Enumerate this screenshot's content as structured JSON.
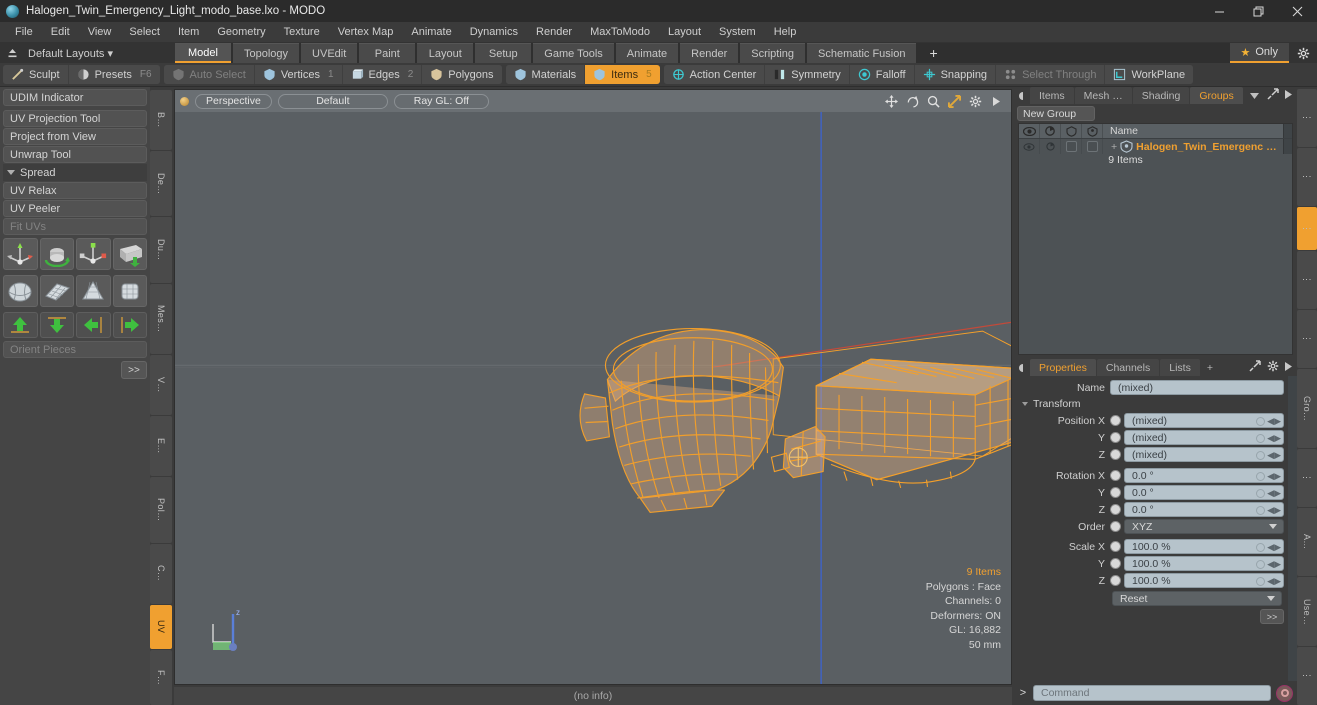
{
  "window": {
    "title": "Halogen_Twin_Emergency_Light_modo_base.lxo - MODO",
    "logo_icon": "modo-logo-icon",
    "minimize_icon": "minimize-icon",
    "maximize_icon": "maximize-icon",
    "close_icon": "close-icon"
  },
  "menubar": {
    "items": [
      "File",
      "Edit",
      "View",
      "Select",
      "Item",
      "Geometry",
      "Texture",
      "Vertex Map",
      "Animate",
      "Dynamics",
      "Render",
      "MaxToModo",
      "Layout",
      "System",
      "Help"
    ]
  },
  "layoutbar": {
    "upload_icon": "upload-icon",
    "default_layouts": "Default Layouts",
    "tabs": [
      {
        "label": "Model",
        "active": true
      },
      {
        "label": "Topology",
        "active": false
      },
      {
        "label": "UVEdit",
        "active": false
      },
      {
        "label": "Paint",
        "active": false
      },
      {
        "label": "Layout",
        "active": false
      },
      {
        "label": "Setup",
        "active": false
      },
      {
        "label": "Game Tools",
        "active": false
      },
      {
        "label": "Animate",
        "active": false
      },
      {
        "label": "Render",
        "active": false
      },
      {
        "label": "Scripting",
        "active": false
      },
      {
        "label": "Schematic Fusion",
        "active": false
      }
    ],
    "add_tab": "+",
    "only_label": "Only",
    "star_icon": "star-icon",
    "gear_icon": "gear-icon"
  },
  "modebar": {
    "group1": [
      {
        "label": "Sculpt",
        "icon": "brush-icon",
        "state": "normal",
        "num": ""
      },
      {
        "label": "Presets",
        "icon": "sphere-icon",
        "state": "normal",
        "num": "F6"
      }
    ],
    "group2": [
      {
        "label": "Auto Select",
        "icon": "shield-icon",
        "state": "disabled",
        "num": ""
      },
      {
        "label": "Vertices",
        "icon": "shield-icon",
        "state": "normal",
        "num": "1"
      },
      {
        "label": "Edges",
        "icon": "cube-icon",
        "state": "normal",
        "num": "2"
      },
      {
        "label": "Polygons",
        "icon": "shield-icon",
        "state": "normal",
        "num": ""
      }
    ],
    "group3": [
      {
        "label": "Materials",
        "icon": "shield-icon",
        "state": "normal",
        "num": ""
      },
      {
        "label": "Items",
        "icon": "shield-icon",
        "state": "active",
        "num": "5"
      }
    ],
    "group4": [
      {
        "label": "Action Center",
        "icon": "crosshair-icon",
        "state": "normal",
        "num": ""
      },
      {
        "label": "Symmetry",
        "icon": "symmetry-icon",
        "state": "normal",
        "num": ""
      },
      {
        "label": "Falloff",
        "icon": "falloff-icon",
        "state": "normal",
        "num": ""
      },
      {
        "label": "Snapping",
        "icon": "snap-icon",
        "state": "normal",
        "num": ""
      },
      {
        "label": "Select Through",
        "icon": "select-through-icon",
        "state": "disabled",
        "num": ""
      },
      {
        "label": "WorkPlane",
        "icon": "workplane-icon",
        "state": "normal",
        "num": ""
      }
    ]
  },
  "leftpanel": {
    "buttons": [
      {
        "label": "UDIM Indicator",
        "dim": false
      },
      {
        "label": "UV Projection Tool",
        "dim": false
      },
      {
        "label": "Project from View",
        "dim": false
      },
      {
        "label": "Unwrap Tool",
        "dim": false
      }
    ],
    "section": "Spread",
    "buttons2": [
      {
        "label": "UV Relax",
        "dim": false
      },
      {
        "label": "UV Peeler",
        "dim": false
      },
      {
        "label": "Fit UVs",
        "dim": true
      }
    ],
    "icon_row1": [
      "uv-move-icon",
      "uv-rotate-icon",
      "uv-scale-icon",
      "uv-fit-icon"
    ],
    "icon_row2": [
      "uv-sphere-icon",
      "uv-plane-icon",
      "uv-cone-icon",
      "uv-cube-icon"
    ],
    "arrow_row": [
      "arrow-up-icon",
      "arrow-down-icon",
      "arrow-left-icon",
      "arrow-right-icon"
    ],
    "orient_pieces": "Orient Pieces",
    "fastforward": ">>",
    "vtabs": [
      {
        "label": "B…",
        "active": false
      },
      {
        "label": "De…",
        "active": false
      },
      {
        "label": "Du…",
        "active": false
      },
      {
        "label": "Mes…",
        "active": false
      },
      {
        "label": "V…",
        "active": false
      },
      {
        "label": "E…",
        "active": false
      },
      {
        "label": "Pol…",
        "active": false
      },
      {
        "label": "C…",
        "active": false
      },
      {
        "label": "UV",
        "active": true
      },
      {
        "label": "F…",
        "active": false
      }
    ]
  },
  "viewport": {
    "dot_icon": "viewport-dot-icon",
    "view_mode": "Perspective",
    "shading": "Default",
    "raygl": "Ray GL: Off",
    "tool_icons": [
      "move-icon",
      "rotate-icon",
      "zoom-icon",
      "fit-icon",
      "gear-icon",
      "play-icon"
    ],
    "info": {
      "items": "9 Items",
      "polygons": "Polygons : Face",
      "channels": "Channels: 0",
      "deformers": "Deformers: ON",
      "gl": "GL: 16,882",
      "scale": "50 mm"
    },
    "axis_gizmo_icon": "axis-gizmo-icon",
    "model_color": "#f5a02a",
    "bg_color": "#5a5f63"
  },
  "statusbar": {
    "text": "(no info)"
  },
  "rightpanel": {
    "top_tabs": [
      {
        "label": "Items",
        "active": false
      },
      {
        "label": "Mesh …",
        "active": false
      },
      {
        "label": "Shading",
        "active": false
      },
      {
        "label": "Groups",
        "active": true
      }
    ],
    "top_tab_icons": [
      "chevron-down-icon",
      "expand-icon",
      "play-icon"
    ],
    "new_group_btn": "New Group",
    "group_columns": [
      "eye-icon",
      "render-icon",
      "lock-icon",
      "wire-icon"
    ],
    "name_header": "Name",
    "group_item": {
      "icon": "group-item-icon",
      "name": "Halogen_Twin_Emergenc …",
      "subtitle": "9 Items"
    },
    "prop_tabs": [
      {
        "label": "Properties",
        "active": true
      },
      {
        "label": "Channels",
        "active": false
      },
      {
        "label": "Lists",
        "active": false
      },
      {
        "label": "+",
        "active": false
      }
    ],
    "prop_tab_icons": [
      "expand-icon",
      "gear-icon",
      "play-icon"
    ],
    "properties": {
      "name_label": "Name",
      "name_value": "(mixed)",
      "transform_section": "Transform",
      "rows": [
        {
          "label": "Position X",
          "value": "(mixed)"
        },
        {
          "label": "Y",
          "value": "(mixed)"
        },
        {
          "label": "Z",
          "value": "(mixed)"
        },
        {
          "label": "Rotation X",
          "value": "0.0 °"
        },
        {
          "label": "Y",
          "value": "0.0 °"
        },
        {
          "label": "Z",
          "value": "0.0 °"
        }
      ],
      "order_label": "Order",
      "order_value": "XYZ",
      "scale_rows": [
        {
          "label": "Scale X",
          "value": "100.0 %"
        },
        {
          "label": "Y",
          "value": "100.0 %"
        },
        {
          "label": "Z",
          "value": "100.0 %"
        }
      ],
      "reset_value": "Reset",
      "fastforward": ">>"
    },
    "vtabs": [
      {
        "label": "⋮",
        "active": false
      },
      {
        "label": "⋮",
        "active": false
      },
      {
        "label": "⋮",
        "active": true
      },
      {
        "label": "⋮",
        "active": false
      },
      {
        "label": "⋮",
        "active": false
      },
      {
        "label": "Gro…",
        "active": false
      },
      {
        "label": "⋮",
        "active": false
      },
      {
        "label": "A…",
        "active": false
      },
      {
        "label": "Use…",
        "active": false
      },
      {
        "label": "⋮",
        "active": false
      }
    ]
  },
  "command": {
    "prompt": ">",
    "placeholder": "Command",
    "record_icon": "record-icon"
  }
}
